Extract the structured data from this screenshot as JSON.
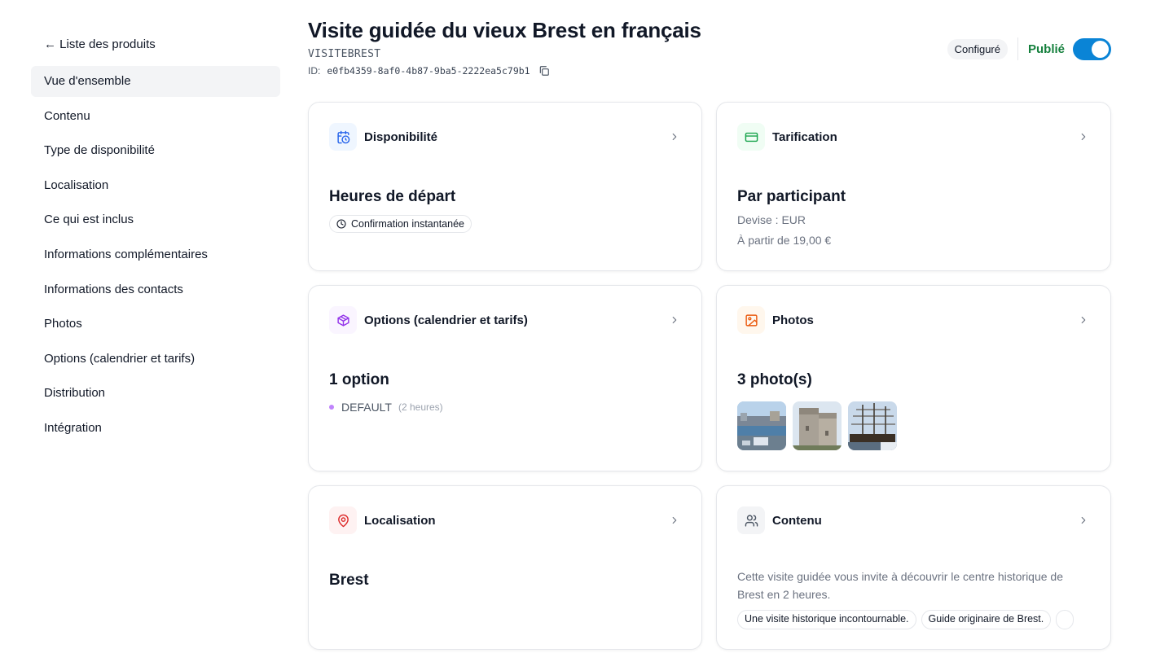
{
  "sidebar": {
    "back_label": "← Liste des produits",
    "items": [
      {
        "label": "Vue d'ensemble",
        "active": true
      },
      {
        "label": "Contenu"
      },
      {
        "label": "Type de disponibilité"
      },
      {
        "label": "Localisation"
      },
      {
        "label": "Ce qui est inclus"
      },
      {
        "label": "Informations complémentaires"
      },
      {
        "label": "Informations des contacts"
      },
      {
        "label": "Photos"
      },
      {
        "label": "Options (calendrier et tarifs)"
      },
      {
        "label": "Distribution"
      },
      {
        "label": "Intégration"
      }
    ]
  },
  "header": {
    "title": "Visite guidée du vieux Brest en français",
    "code": "VISITEBREST",
    "id_label": "ID:",
    "id_value": "e0fb4359-8af0-4b87-9ba5-2222ea5c79b1",
    "badge": "Configuré",
    "published_label": "Publié",
    "published": true
  },
  "cards": {
    "availability": {
      "title": "Disponibilité",
      "main": "Heures de départ",
      "pill": "Confirmation instantanée",
      "icon": "calendar-clock-icon",
      "color": "#2563eb"
    },
    "pricing": {
      "title": "Tarification",
      "main": "Par participant",
      "currency": "Devise : EUR",
      "from": "À partir de 19,00 €",
      "icon": "credit-card-icon",
      "color": "#16a34a"
    },
    "options": {
      "title": "Options (calendrier et tarifs)",
      "main": "1 option",
      "items": [
        {
          "name": "DEFAULT",
          "duration": "(2 heures)"
        }
      ],
      "icon": "package-icon",
      "color": "#9333ea"
    },
    "photos": {
      "title": "Photos",
      "main": "3 photo(s)",
      "icon": "image-icon",
      "color": "#ea580c"
    },
    "location": {
      "title": "Localisation",
      "main": "Brest",
      "icon": "map-pin-icon",
      "color": "#dc2626"
    },
    "content": {
      "title": "Contenu",
      "description": "Cette visite guidée vous invite à découvrir le centre historique de Brest en 2 heures.",
      "tags": [
        "Une visite historique incontournable.",
        "Guide originaire de Brest."
      ],
      "icon": "users-icon",
      "color": "#4b5563"
    }
  }
}
